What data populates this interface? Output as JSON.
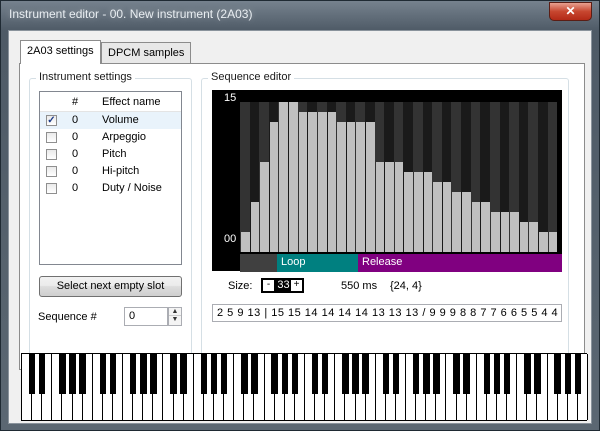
{
  "window": {
    "title": "Instrument editor - 00. New instrument (2A03)",
    "close_label": "✕"
  },
  "tabs": [
    {
      "label": "2A03 settings",
      "active": true
    },
    {
      "label": "DPCM samples",
      "active": false
    }
  ],
  "instrument_settings": {
    "legend": "Instrument settings",
    "columns": {
      "num": "#",
      "name": "Effect name"
    },
    "rows": [
      {
        "checked": true,
        "num": "0",
        "name": "Volume",
        "selected": true
      },
      {
        "checked": false,
        "num": "0",
        "name": "Arpeggio",
        "selected": false
      },
      {
        "checked": false,
        "num": "0",
        "name": "Pitch",
        "selected": false
      },
      {
        "checked": false,
        "num": "0",
        "name": "Hi-pitch",
        "selected": false
      },
      {
        "checked": false,
        "num": "0",
        "name": "Duty / Noise",
        "selected": false
      }
    ],
    "select_next_label": "Select next empty slot",
    "sequence_label": "Sequence #",
    "sequence_value": "0"
  },
  "sequence_editor": {
    "legend": "Sequence editor",
    "y_max_label": "15",
    "y_min_label": "00",
    "values": [
      2,
      5,
      9,
      13,
      15,
      15,
      14,
      14,
      14,
      14,
      13,
      13,
      13,
      13,
      9,
      9,
      9,
      8,
      8,
      8,
      7,
      7,
      6,
      6,
      5,
      5,
      4,
      4,
      4,
      3,
      3,
      2,
      2,
      0
    ],
    "loop_label": "Loop",
    "release_label": "Release",
    "loop_start_index": 0,
    "release_start_index": 0,
    "size_label": "Size:",
    "size_minus": "-",
    "size_value": "33",
    "size_plus": "+",
    "duration": "550 ms",
    "cursor_info": "{24, 4}",
    "mml_text": "2 5 9 13 | 15 15 14 14 14 14 13 13 13 / 9 9 9 8 8 7 7 6 6 5 5 4 4 3 3 2 2 0"
  },
  "piano": {
    "octaves": 8
  },
  "colors": {
    "loop": "#008080",
    "release": "#800080",
    "bar": "#c0c0c0",
    "grid": "#404040"
  }
}
